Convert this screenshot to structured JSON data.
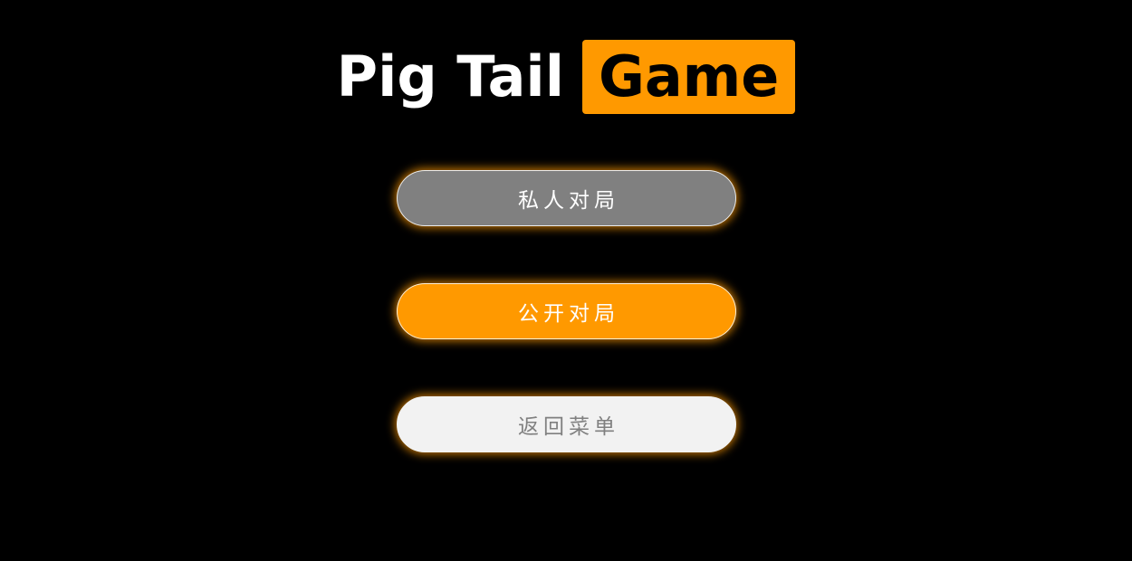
{
  "title": {
    "plain": "Pig Tail",
    "badge": "Game"
  },
  "menu": {
    "private_label": "私人对局",
    "public_label": "公开对局",
    "back_label": "返回菜单"
  },
  "colors": {
    "background": "#000000",
    "accent": "#ff9900",
    "private_button": "#808080",
    "back_button": "#f2f2f2"
  }
}
